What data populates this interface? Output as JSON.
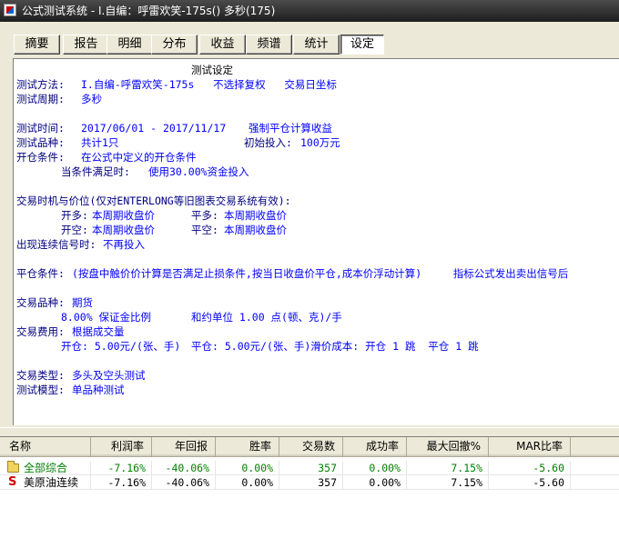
{
  "window": {
    "title": "公式测试系统 - I.自编：呼雷欢笑-175s() 多秒(175)"
  },
  "tabs": [
    {
      "label": "摘要"
    },
    {
      "label": "报告"
    },
    {
      "label": "明细"
    },
    {
      "label": "分布"
    },
    {
      "label": "收益"
    },
    {
      "label": "频谱"
    },
    {
      "label": "统计"
    },
    {
      "label": "设定",
      "active": true
    }
  ],
  "report": {
    "heading": "测试设定",
    "method_label": "测试方法:",
    "method_value": "I.自编-呼雷欢笑-175s   不选择复权   交易日坐标",
    "period_label": "测试周期:",
    "period_value": "多秒",
    "time_label": "测试时间:",
    "time_value": "2017/06/01 - 2017/11/17",
    "force_close": "强制平仓计算收益",
    "variety_label": "测试品种:",
    "variety_value": "共计1只",
    "initial_label": "初始投入:",
    "initial_value": "100万元",
    "open_label": "开仓条件:",
    "open_value": "在公式中定义的开仓条件",
    "cond_label": "当条件满足时:",
    "cond_value": "使用30.00%资金投入",
    "timing_title": "交易时机与价位(仅对ENTERLONG等旧图表交易系统有效):",
    "open_long_label": "开多:",
    "open_long_value": "本周期收盘价",
    "close_long_label": "平多:",
    "close_long_value": "本周期收盘价",
    "open_short_label": "开空:",
    "open_short_value": "本周期收盘价",
    "close_short_label": "平空:",
    "close_short_value": "本周期收盘价",
    "consecutive_label": "出现连续信号时:",
    "consecutive_value": "不再投入",
    "close_cond_label": "平仓条件:",
    "close_cond_value": "(按盘中触价价计算是否满足止损条件,按当日收盘价平仓,成本价浮动计算)     指标公式发出卖出信号后",
    "trade_variety_label": "交易品种:",
    "trade_variety_value": "期货",
    "margin_value": "8.00% 保证金比例",
    "unit_value": "和约单位 1.00 点(顿、克)/手",
    "fee_label": "交易费用:",
    "fee_value": "根据成交量",
    "fee_open": "开仓: 5.00元/(张、手)",
    "fee_close": "平仓: 5.00元/(张、手)滑价成本: 开仓 1 跳  平仓 1 跳",
    "type_label": "交易类型:",
    "type_value": "多头及空头测试",
    "model_label": "测试模型:",
    "model_value": "单品种测试"
  },
  "table": {
    "columns": [
      "名称",
      "利润率",
      "年回报",
      "胜率",
      "交易数",
      "成功率",
      "最大回撤%",
      "MAR比率"
    ],
    "rows": [
      {
        "icon": "folder-icon",
        "icon_glyph": "",
        "name": "全部综合",
        "name_color": "#008000",
        "values": [
          "-7.16%",
          "-40.06%",
          "0.00%",
          "357",
          "0.00%",
          "7.15%",
          "-5.60"
        ],
        "color": "#008000"
      },
      {
        "icon": "s-icon",
        "icon_glyph": "S",
        "name": "美原油连续",
        "name_color": "#000000",
        "values": [
          "-7.16%",
          "-40.06%",
          "0.00%",
          "357",
          "0.00%",
          "7.15%",
          "-5.60"
        ],
        "color": "#000000"
      }
    ]
  }
}
